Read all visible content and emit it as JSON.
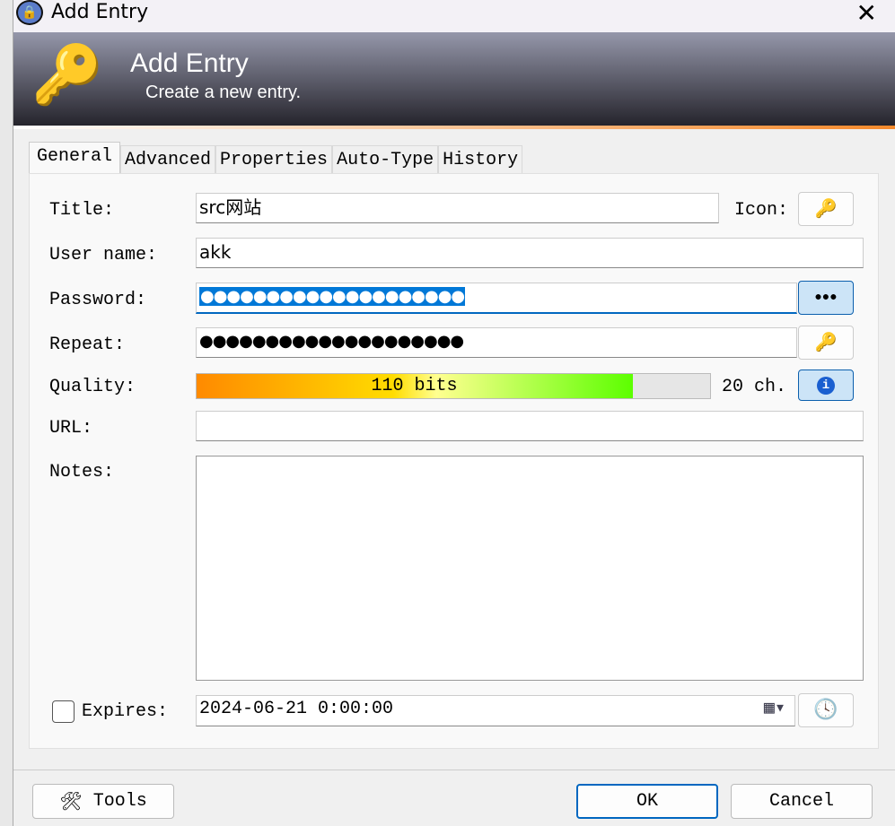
{
  "window": {
    "title": "Add Entry"
  },
  "banner": {
    "title": "Add Entry",
    "subtitle": "Create a new entry."
  },
  "tabs": [
    "General",
    "Advanced",
    "Properties",
    "Auto-Type",
    "History"
  ],
  "fields": {
    "title_label": "Title:",
    "title_value": "src网站",
    "icon_label": "Icon:",
    "username_label": "User name:",
    "username_value": "akk",
    "password_label": "Password:",
    "password_value": "●●●●●●●●●●●●●●●●●●●●",
    "repeat_label": "Repeat:",
    "repeat_value": "●●●●●●●●●●●●●●●●●●●●",
    "quality_label": "Quality:",
    "quality_text": "110 bits",
    "quality_percent": 85,
    "char_count": "20 ch.",
    "url_label": "URL:",
    "url_value": "",
    "notes_label": "Notes:",
    "notes_value": "",
    "expires_label": "Expires:",
    "expires_checked": false,
    "expires_value": "2024-06-21  0:00:00"
  },
  "buttons": {
    "show_password": "●●●",
    "tools": "Tools",
    "ok": "OK",
    "cancel": "Cancel"
  }
}
